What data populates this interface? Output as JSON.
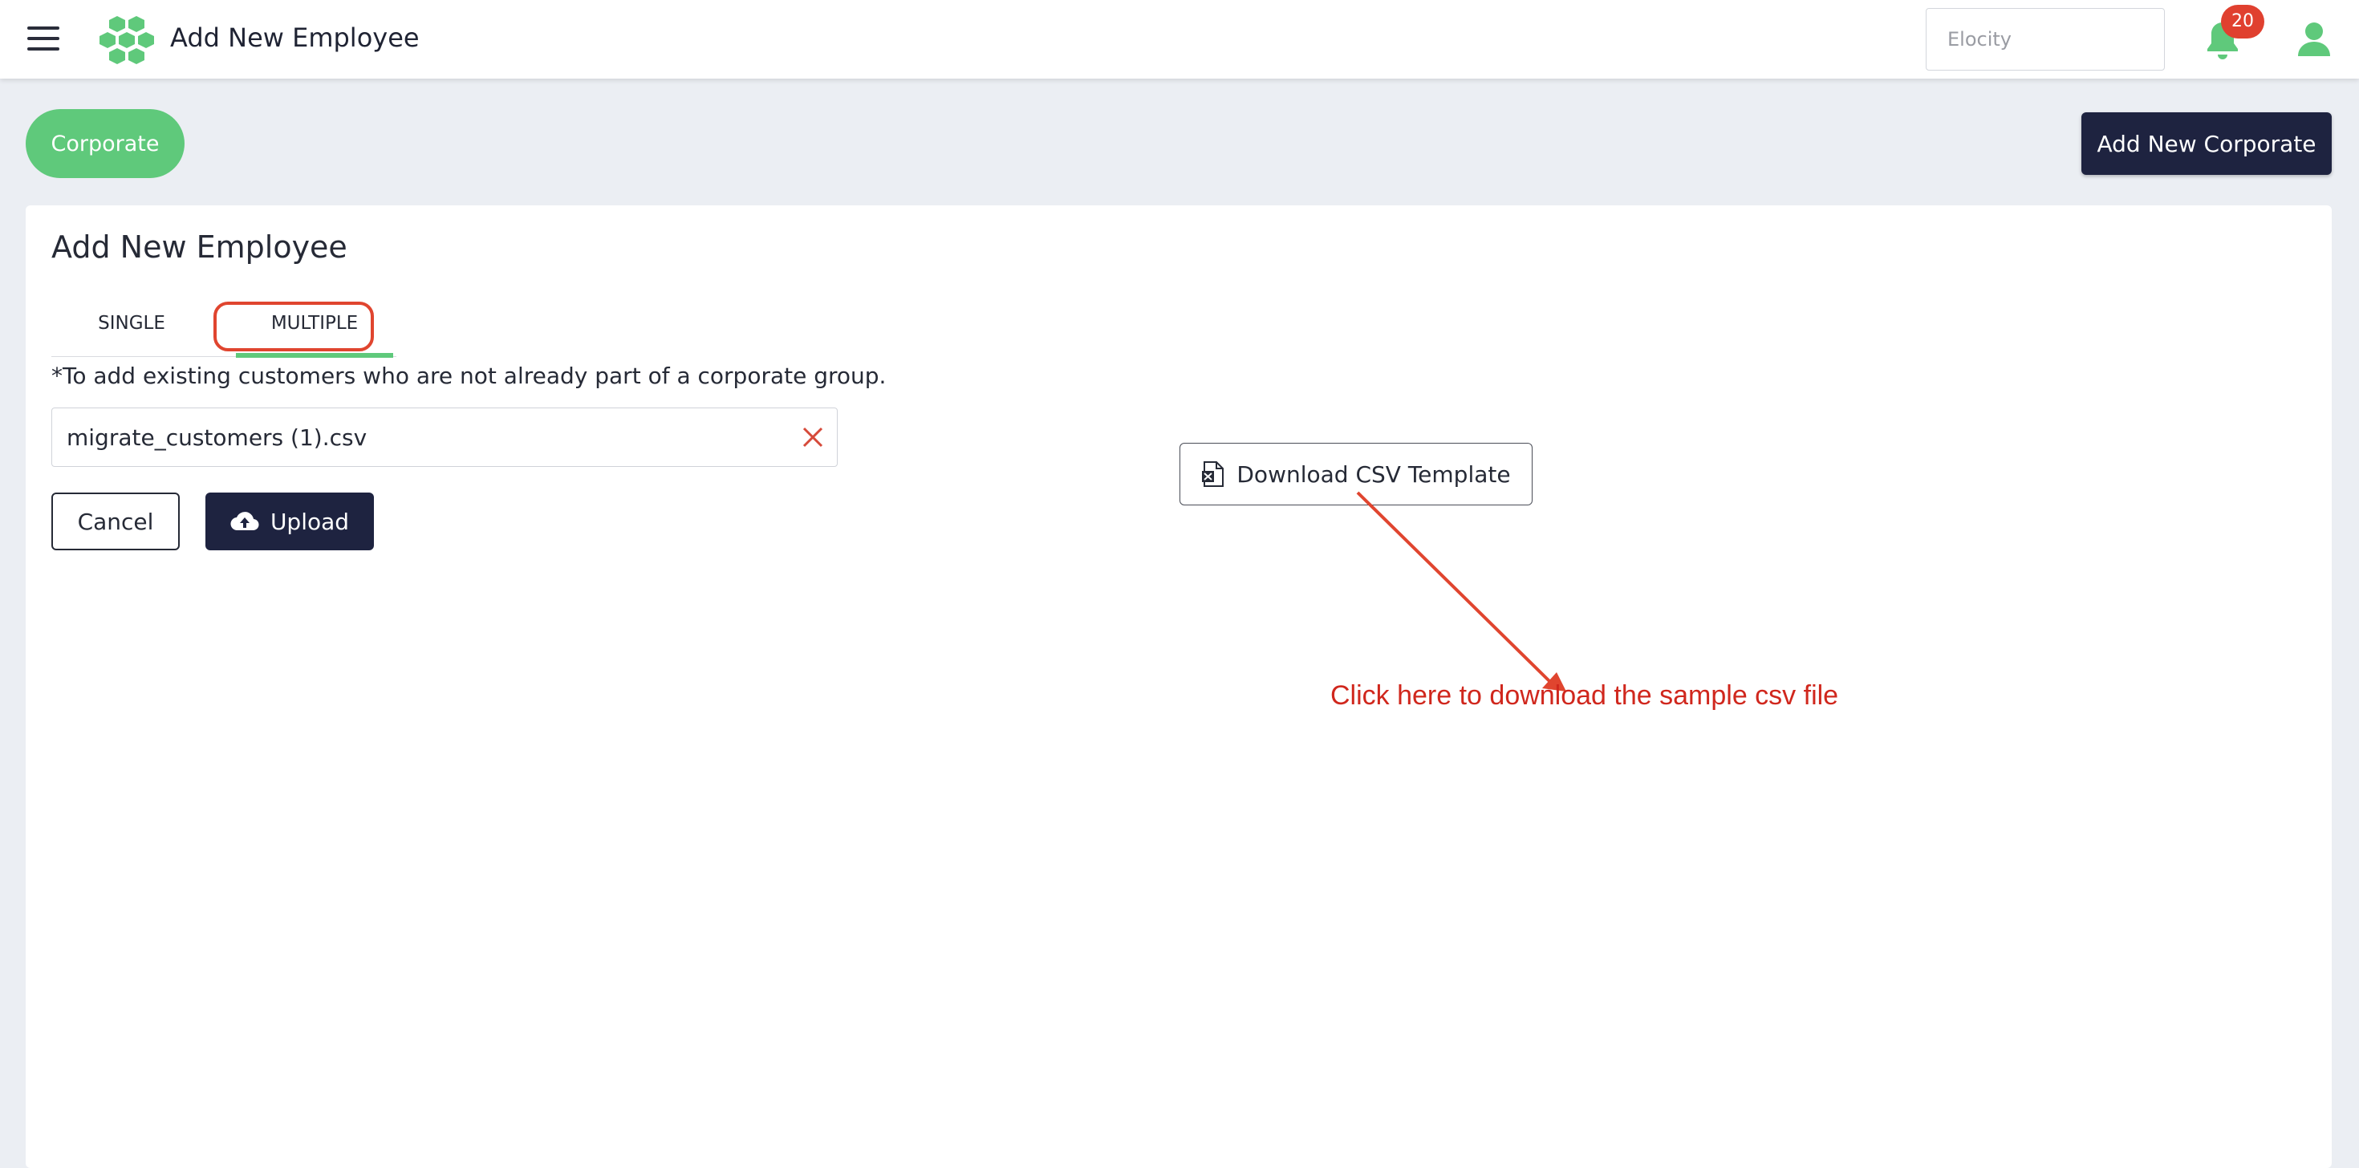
{
  "header": {
    "title": "Add New Employee",
    "tenant_placeholder": "Elocity",
    "notification_count": "20",
    "icons": [
      "menu-icon",
      "hexagon-logo",
      "bell-icon",
      "user-icon"
    ]
  },
  "subheader": {
    "corporate_label": "Corporate",
    "add_corporate_label": "Add New Corporate"
  },
  "card": {
    "title": "Add New Employee",
    "tabs": [
      {
        "label": "SINGLE",
        "active": false
      },
      {
        "label": "MULTIPLE",
        "active": true
      }
    ],
    "note": "*To add existing customers who are not already part of a corporate group.",
    "file_name": "migrate_customers (1).csv",
    "cancel_label": "Cancel",
    "upload_label": "Upload",
    "download_label": "Download CSV Template"
  },
  "annotation": {
    "text": "Click here to download the sample csv file",
    "color": "#d0271d"
  },
  "colors": {
    "accent_green": "#5fc97b",
    "navy": "#1e2340",
    "badge_red": "#e0402f"
  }
}
